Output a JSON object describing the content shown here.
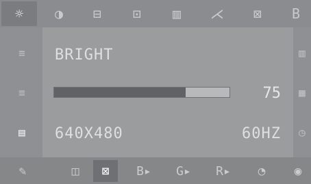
{
  "osd": {
    "top_icons": [
      {
        "name": "brightness-sun-icon",
        "glyph": "☼"
      },
      {
        "name": "contrast-icon",
        "glyph": "◑"
      },
      {
        "name": "h-position-icon",
        "glyph": "⊟"
      },
      {
        "name": "v-position-icon",
        "glyph": "⊡"
      },
      {
        "name": "h-size-icon",
        "glyph": "▥"
      },
      {
        "name": "pincushion-icon",
        "glyph": "⋌"
      },
      {
        "name": "trapezoid-icon",
        "glyph": "⊠"
      },
      {
        "name": "color-b-icon",
        "glyph": "B"
      }
    ],
    "left_icons": [
      {
        "name": "left-menu-icon-1",
        "glyph": "≡"
      },
      {
        "name": "left-menu-icon-2",
        "glyph": "≡"
      },
      {
        "name": "left-menu-icon-3",
        "glyph": "▤"
      },
      {
        "name": "left-menu-icon-4",
        "glyph": "✎"
      }
    ],
    "right_icons": [
      {
        "name": "right-menu-icon-1",
        "glyph": "▥"
      },
      {
        "name": "right-menu-icon-2",
        "glyph": "▦"
      },
      {
        "name": "right-menu-icon-3",
        "glyph": "◷"
      }
    ],
    "bottom_icons": [
      {
        "name": "rgb-icon",
        "glyph": "◫"
      },
      {
        "name": "zoom-icon",
        "glyph": "⊠"
      },
      {
        "name": "blue-gain-icon",
        "glyph": "B▸"
      },
      {
        "name": "green-gain-icon",
        "glyph": "G▸"
      },
      {
        "name": "red-gain-icon",
        "glyph": "R▸"
      },
      {
        "name": "color-temp-icon",
        "glyph": "◔"
      },
      {
        "name": "globe-icon",
        "glyph": "◉"
      }
    ],
    "setting_label": "BRIGHT",
    "value": "75",
    "level": 0.75,
    "resolution": "640X480",
    "refresh_rate": "60HZ",
    "colors": {
      "background": "#8e9093",
      "panel": "#9a9c9e",
      "text": "#dedfe0",
      "bar_fill": "#606265",
      "bar_track": "#b7b9bb"
    }
  }
}
